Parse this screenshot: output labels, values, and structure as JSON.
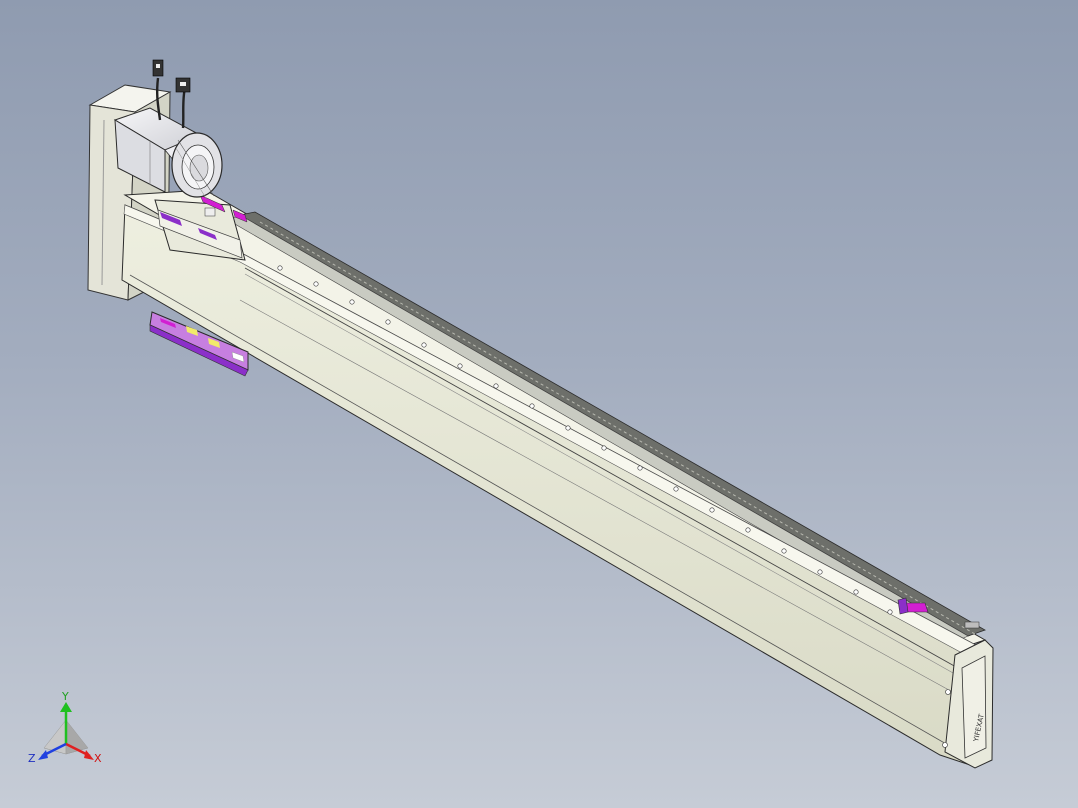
{
  "viewport": {
    "background_top": "#8f9bb0",
    "background_bottom": "#c6ccd6"
  },
  "model": {
    "body_color": "#e5e6d4",
    "edge_color": "#2b2b2b",
    "rail_color": "#c9cbc2",
    "accent_magenta": "#d21fd2",
    "accent_purple": "#8b2fc9",
    "accent_yellow": "#f2ea6a",
    "motor_color": "#ececee",
    "end_cap_logo": "YIFEXAT"
  },
  "triad": {
    "x_label": "X",
    "y_label": "Y",
    "z_label": "Z",
    "x_color": "#e02020",
    "y_color": "#20c020",
    "z_color": "#2040e0"
  }
}
